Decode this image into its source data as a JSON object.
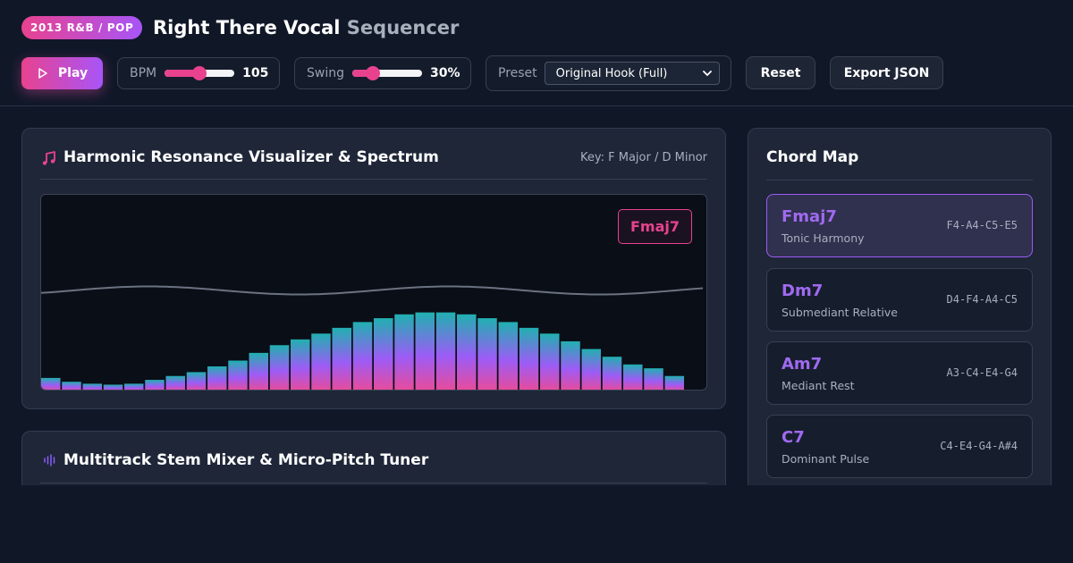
{
  "header": {
    "badge": "2013 R&B / POP",
    "title_main": "Right There Vocal",
    "title_sub": "Sequencer"
  },
  "toolbar": {
    "play_label": "Play",
    "bpm": {
      "label": "BPM",
      "value": "105",
      "level": 0.5
    },
    "swing": {
      "label": "Swing",
      "value": "30%",
      "level": 0.3
    },
    "preset": {
      "label": "Preset",
      "selected": "Original Hook (Full)"
    },
    "reset_label": "Reset",
    "export_label": "Export JSON"
  },
  "visualizer": {
    "title": "Harmonic Resonance Visualizer & Spectrum",
    "key": "Key: F Major / D Minor",
    "current_chord": "Fmaj7",
    "spectrum_levels": [
      0.07,
      0.05,
      0.04,
      0.035,
      0.04,
      0.06,
      0.08,
      0.1,
      0.13,
      0.16,
      0.2,
      0.24,
      0.27,
      0.3,
      0.33,
      0.36,
      0.38,
      0.4,
      0.41,
      0.41,
      0.4,
      0.38,
      0.36,
      0.33,
      0.3,
      0.26,
      0.22,
      0.18,
      0.14,
      0.12,
      0.08
    ],
    "colors": {
      "bar_top": "#20b0b0",
      "bar_mid": "#9c5cf6",
      "bar_bottom": "#ea4b98",
      "wave": "#6b7280"
    }
  },
  "mixer": {
    "title": "Multitrack Stem Mixer & Micro-Pitch Tuner"
  },
  "chord_map": {
    "title": "Chord Map",
    "chords": [
      {
        "name": "Fmaj7",
        "role": "Tonic Harmony",
        "notes": "F4-A4-C5-E5",
        "active": true
      },
      {
        "name": "Dm7",
        "role": "Submediant Relative",
        "notes": "D4-F4-A4-C5",
        "active": false
      },
      {
        "name": "Am7",
        "role": "Mediant Rest",
        "notes": "A3-C4-E4-G4",
        "active": false
      },
      {
        "name": "C7",
        "role": "Dominant Pulse",
        "notes": "C4-E4-G4-A#4",
        "active": false
      }
    ]
  },
  "colors": {
    "accent_pink": "#e8428f",
    "accent_purple": "#a855f7",
    "background": "#101828",
    "panel": "#1e2638"
  }
}
